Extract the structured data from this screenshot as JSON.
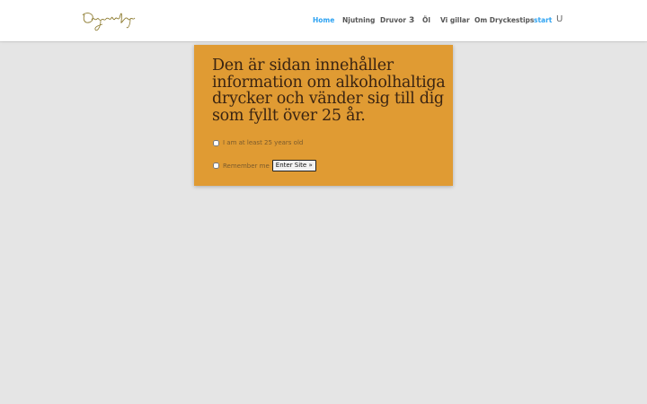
{
  "header": {
    "logo_text": "Dryckestips",
    "nav": [
      {
        "label": "Home",
        "active": true
      },
      {
        "label": "Njutning",
        "active": false
      },
      {
        "label": "Druvor",
        "active": false,
        "dropdown": "3"
      },
      {
        "label": "Öl",
        "active": false
      },
      {
        "label": "Vi gillar",
        "active": false
      },
      {
        "label": "Om Dryckestips",
        "active": false
      },
      {
        "label": "start",
        "active": true
      }
    ],
    "search_icon": "U"
  },
  "age_gate": {
    "title": "Den är sidan innehåller information om alkoholhaltiga drycker och vänder sig till dig som fyllt över 25 år.",
    "age_checkbox_label": "I am at least 25 years old",
    "remember_label": "Remember me",
    "enter_button": "Enter Site »"
  },
  "colors": {
    "page_bg": "#e5e5e5",
    "header_bg": "#ffffff",
    "accent": "#2ea3f2",
    "gate_bg": "#e09b33"
  }
}
